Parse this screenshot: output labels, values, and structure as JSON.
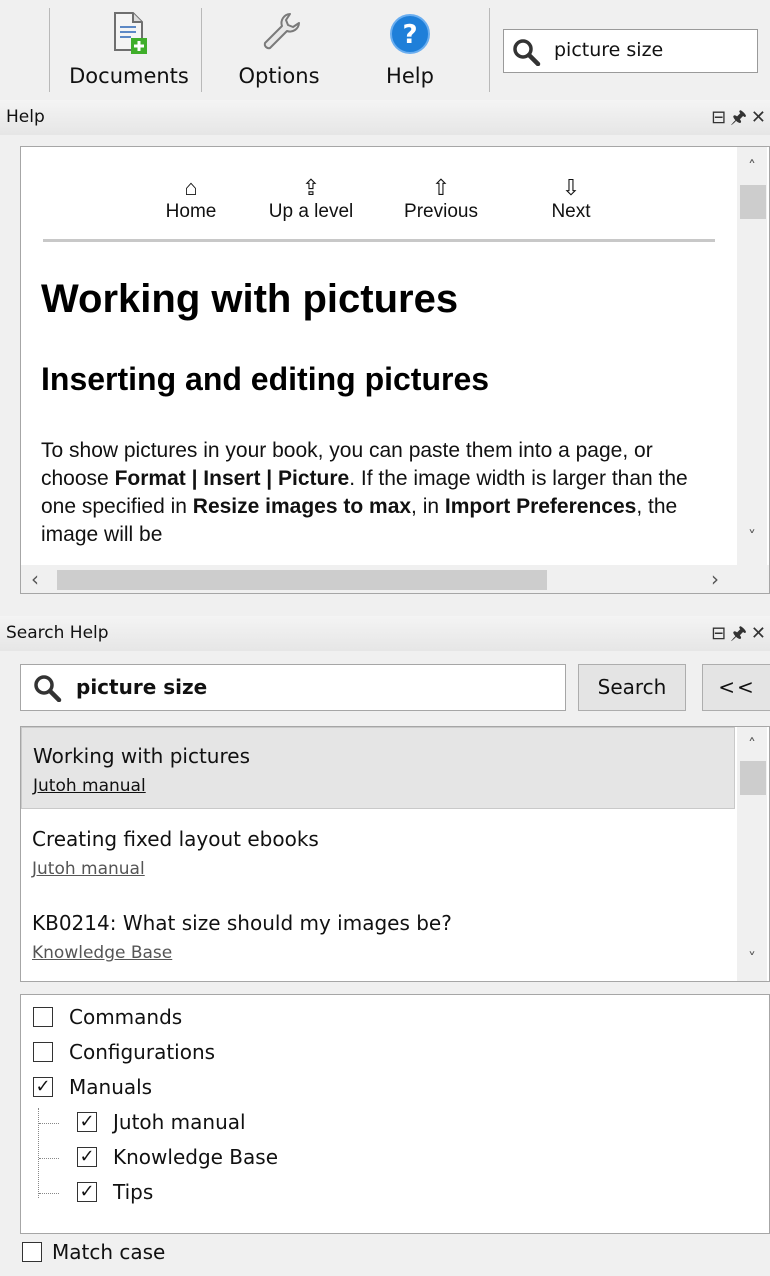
{
  "toolbar": {
    "documents_label": "Documents",
    "options_label": "Options",
    "help_label": "Help",
    "search_value": "picture size"
  },
  "help_pane": {
    "title": "Help",
    "nav": {
      "home": "Home",
      "up": "Up a level",
      "previous": "Previous",
      "next": "Next"
    },
    "heading1": "Working with pictures",
    "heading2": "Inserting and editing pictures",
    "para": {
      "t1": "To show pictures in your book, you can paste them into a page, or choose ",
      "b1": "Format | Insert | Picture",
      "t2": ". If the image width is larger than the one specified in ",
      "b2": "Resize images to max",
      "t3": ", in ",
      "b3": "Import Preferences",
      "t4": ", the image will be"
    }
  },
  "search_pane": {
    "title": "Search Help",
    "query": "picture size",
    "search_button": "Search",
    "collapse_button": "<<",
    "results": [
      {
        "title": "Working with pictures",
        "source": "Jutoh manual",
        "selected": true
      },
      {
        "title": "Creating fixed layout ebooks",
        "source": "Jutoh manual",
        "selected": false
      },
      {
        "title": "KB0214: What size should my images be?",
        "source": "Knowledge Base",
        "selected": false
      }
    ],
    "filters": {
      "commands": {
        "label": "Commands",
        "checked": false
      },
      "configurations": {
        "label": "Configurations",
        "checked": false
      },
      "manuals": {
        "label": "Manuals",
        "checked": true
      },
      "jutoh_manual": {
        "label": "Jutoh manual",
        "checked": true
      },
      "knowledge_base": {
        "label": "Knowledge Base",
        "checked": true
      },
      "tips": {
        "label": "Tips",
        "checked": true
      }
    },
    "match_case": {
      "label": "Match case",
      "checked": false
    }
  },
  "icons": {
    "documents": "document-add-icon",
    "options": "wrench-icon",
    "help": "help-question-icon",
    "search": "search-icon"
  },
  "colors": {
    "help_blue": "#1e7fd9",
    "doc_green": "#3fae2a"
  }
}
